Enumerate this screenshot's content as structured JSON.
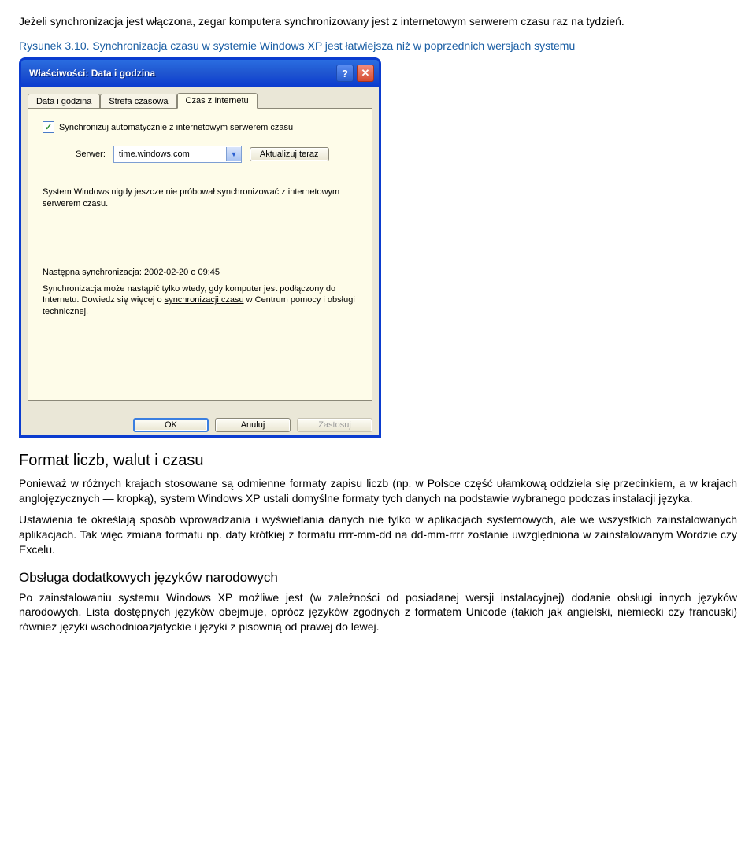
{
  "intro_paragraph": "Jeżeli synchronizacja jest włączona, zegar komputera synchronizowany jest z internetowym serwerem czasu raz na tydzień.",
  "caption": "Rysunek 3.10. Synchronizacja czasu w systemie Windows XP jest łatwiejsza niż w poprzednich wersjach systemu",
  "dialog": {
    "title": "Właściwości: Data i godzina",
    "help_glyph": "?",
    "close_glyph": "✕",
    "tabs": {
      "t1": "Data i godzina",
      "t2": "Strefa czasowa",
      "t3": "Czas z Internetu"
    },
    "checkbox_label": "Synchronizuj automatycznie z internetowym serwerem czasu",
    "server_label": "Serwer:",
    "server_value": "time.windows.com",
    "update_now": "Aktualizuj teraz",
    "info1": "System Windows nigdy jeszcze nie próbował synchronizować z internetowym serwerem czasu.",
    "next_sync": "Następna synchronizacja: 2002-02-20 o 09:45",
    "info2_a": "Synchronizacja może nastąpić tylko wtedy, gdy komputer jest podłączony do Internetu. Dowiedz się więcej o ",
    "info2_link": "synchronizacji czasu",
    "info2_b": " w Centrum pomocy i obsługi technicznej.",
    "btn_ok": "OK",
    "btn_cancel": "Anuluj",
    "btn_apply": "Zastosuj"
  },
  "section_heading": "Format liczb, walut i czasu",
  "section_paragraph": "Ponieważ w różnych krajach stosowane są odmienne formaty zapisu liczb (np. w Polsce część ułamkową oddziela się przecinkiem, a w krajach anglojęzycznych — kropką), system Windows XP ustali domyślne formaty tych danych na podstawie wybranego podczas instalacji języka.",
  "section_paragraph2": "Ustawienia te określają sposób wprowadzania i wyświetlania danych nie tylko w aplikacjach systemowych, ale we wszystkich zainstalowanych aplikacjach. Tak więc zmiana formatu np. daty krótkiej z formatu rrrr-mm-dd na dd-mm-rrrr zostanie uwzględniona w zainstalowanym Wordzie czy Excelu.",
  "subsection_heading": "Obsługa dodatkowych języków narodowych",
  "subsection_paragraph": "Po zainstalowaniu systemu Windows XP możliwe jest (w zależności od posiadanej wersji instalacyjnej) dodanie obsługi innych języków narodowych. Lista dostępnych języków obejmuje, oprócz języków zgodnych z formatem Unicode (takich jak angielski, niemiecki czy francuski) również języki wschodnioazjatyckie i języki z pisownią od prawej do lewej."
}
